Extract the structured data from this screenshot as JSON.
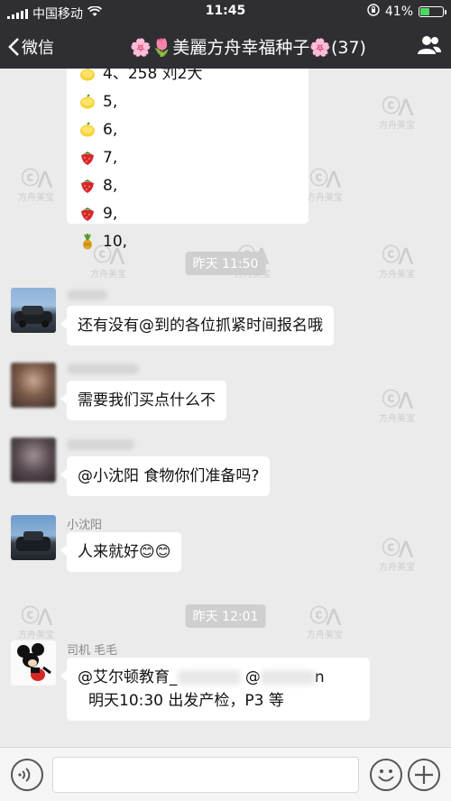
{
  "status": {
    "carrier": "中国移动",
    "time": "11:45",
    "battery": "41%",
    "battery_level": 0.41
  },
  "nav": {
    "back_label": "微信",
    "title": "🌸🌷美麗方舟幸福种子🌸(37)"
  },
  "list": [
    {
      "fruit": "lemon",
      "text": "4、258 刘2大"
    },
    {
      "fruit": "lemon",
      "text": "5,"
    },
    {
      "fruit": "lemon",
      "text": "6,"
    },
    {
      "fruit": "strawberry",
      "text": "7,"
    },
    {
      "fruit": "strawberry",
      "text": "8,"
    },
    {
      "fruit": "strawberry",
      "text": "9,"
    },
    {
      "fruit": "pineapple",
      "text": "10,"
    }
  ],
  "timestamps": [
    "昨天 11:50",
    "昨天 12:01"
  ],
  "messages": [
    {
      "sender": "",
      "text": "还有没有@到的各位抓紧时间报名哦"
    },
    {
      "sender": "",
      "text": "需要我们买点什么不"
    },
    {
      "sender": "",
      "text": "@小沈阳 食物你们准备吗?"
    },
    {
      "sender": "小沈阳",
      "text": "人来就好😊😊"
    },
    {
      "sender": "司机 毛毛",
      "line1_a": "@艾尔顿教育_",
      "line1_b": "@",
      "line1_c": "n",
      "line2": "明天10:30 出发产检，P3 等"
    }
  ],
  "watermark": "方舟美宝"
}
